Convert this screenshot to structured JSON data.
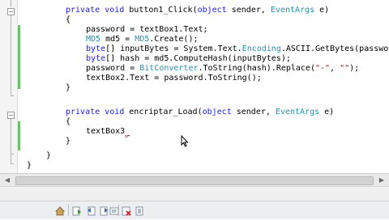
{
  "editor": {
    "lines": [
      [
        "",
        [
          [
            "kw",
            "private "
          ],
          [
            "kw",
            "void "
          ],
          [
            "",
            "button1_Click("
          ],
          [
            "kw",
            "object "
          ],
          [
            "",
            "sender, "
          ],
          [
            "ty",
            "EventArgs "
          ],
          [
            "",
            "e)"
          ]
        ]
      ],
      [
        "",
        [
          [
            "",
            "{"
          ]
        ]
      ],
      [
        "",
        [
          [
            "",
            "password = textBox1.Text;"
          ]
        ]
      ],
      [
        "",
        [
          [
            "ty",
            "MD5 "
          ],
          [
            "",
            "md5 = "
          ],
          [
            "ty",
            "MD5"
          ],
          [
            "",
            ".Create();"
          ]
        ]
      ],
      [
        "",
        [
          [
            "kw",
            "byte"
          ],
          [
            "",
            "[] inputBytes = System.Text."
          ],
          [
            "ty",
            "Encoding"
          ],
          [
            "",
            ".ASCII.GetBytes(passwor"
          ]
        ]
      ],
      [
        "",
        [
          [
            "kw",
            "byte"
          ],
          [
            "",
            "[] hash = md5.ComputeHash(inputBytes);"
          ]
        ]
      ],
      [
        "",
        [
          [
            "",
            "password = "
          ],
          [
            "ty",
            "BitConverter"
          ],
          [
            "",
            ".ToString(hash).Replace("
          ],
          [
            "str",
            "\"-\""
          ],
          [
            "",
            ", "
          ],
          [
            "str",
            "\"\""
          ],
          [
            "",
            ");"
          ]
        ]
      ],
      [
        "",
        [
          [
            "",
            "textBox2.Text = password.ToString();"
          ]
        ]
      ],
      [
        "",
        [
          [
            "",
            "}"
          ]
        ]
      ],
      [
        "",
        [
          [
            "",
            ""
          ]
        ]
      ],
      [
        "",
        [
          [
            "kw",
            "private "
          ],
          [
            "kw",
            "void "
          ],
          [
            "",
            "encriptar_Load("
          ],
          [
            "kw",
            "object "
          ],
          [
            "",
            "sender, "
          ],
          [
            "ty",
            "EventArgs "
          ],
          [
            "",
            "e)"
          ]
        ]
      ],
      [
        "",
        [
          [
            "",
            "{"
          ]
        ]
      ],
      [
        "",
        [
          [
            "",
            "textBox3"
          ],
          [
            "sq",
            "_"
          ]
        ]
      ],
      [
        "",
        [
          [
            "",
            "}"
          ]
        ]
      ],
      [
        "",
        [
          [
            "",
            ""
          ]
        ]
      ],
      [
        "",
        [
          [
            "",
            "}"
          ]
        ]
      ],
      [
        "",
        [
          [
            "",
            "}"
          ]
        ]
      ]
    ]
  },
  "colors": {
    "keyword": "#1a1aff",
    "type": "#2b91af",
    "string": "#a31515",
    "change_bar": "#6cc26a"
  },
  "icons": {
    "hscroll_left": "arrow-left-icon",
    "hscroll_right": "arrow-right-icon",
    "toolbar": [
      "home-icon",
      "forward-arrow-icon",
      "undo-icon",
      "redo-icon",
      "comment-icon",
      "uncomment-icon",
      "delete-icon",
      "bookmark-icon"
    ]
  }
}
